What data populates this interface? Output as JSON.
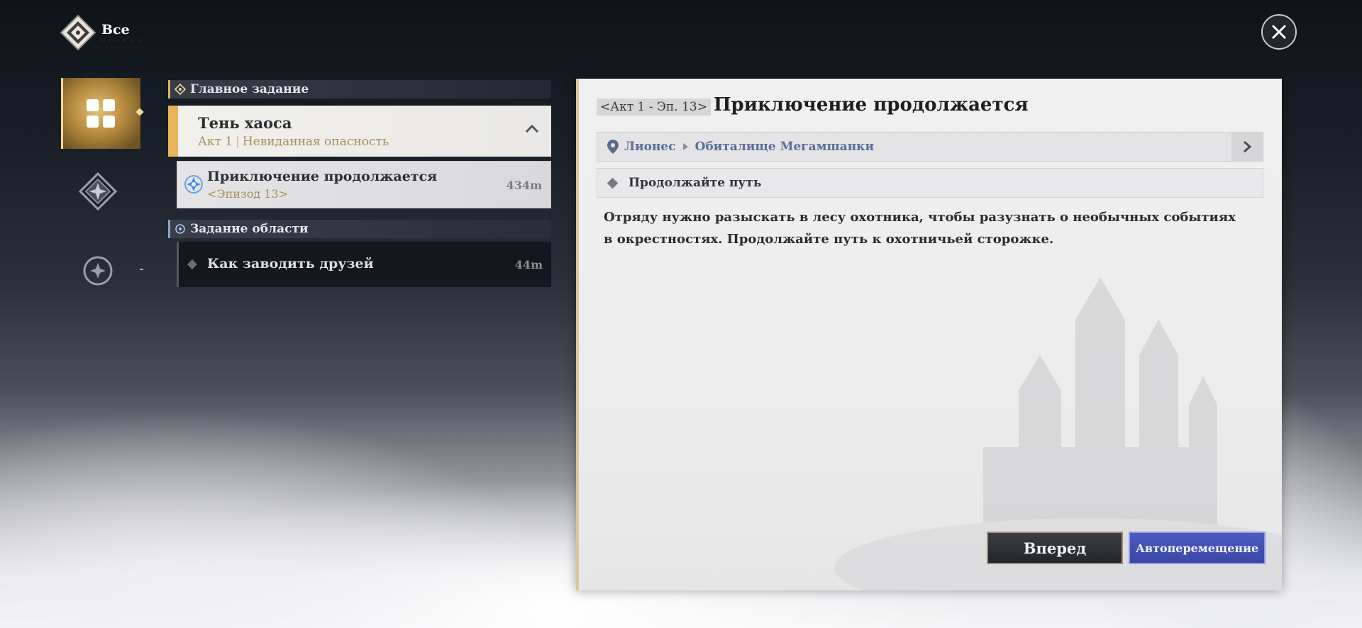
{
  "header": {
    "title": "Все",
    "subtitle": "· · · · · ·"
  },
  "nav": {
    "items": [
      {
        "name": "all-quests",
        "icon": "grid-icon",
        "active": true
      },
      {
        "name": "story",
        "icon": "diamond-star-icon",
        "active": false
      },
      {
        "name": "area",
        "icon": "circle-star-icon",
        "active": false
      }
    ]
  },
  "quests": {
    "main_section_label": "Главное задание",
    "chapter": {
      "title": "Тень хаоса",
      "act": "Акт 1",
      "separator": "|",
      "subtitle": "Невиданная опасность"
    },
    "selected": {
      "title": "Приключение продолжается",
      "episode": "<Эпизод 13>",
      "distance": "434m"
    },
    "area_section_label": "Задание области",
    "area_quest": {
      "title": "Как заводить друзей",
      "distance": "44m"
    }
  },
  "details": {
    "tag": "<Акт 1 - Эп. 13>",
    "title": "Приключение продолжается",
    "location": [
      "Лионес",
      "Обиталище Мегамшанки"
    ],
    "objective": "Продолжайте путь",
    "description": "Отряду нужно разыскать в лесу охотника, чтобы разузнать о необычных событиях в окрестностях. Продолжайте путь к охотничьей сторожке.",
    "buttons": {
      "go": "Вперед",
      "auto": "Автоперемещение"
    }
  },
  "colors": {
    "gold_accent": "#e8b45a",
    "auto_button": "#4c5bc0",
    "location_text": "#5a6f9a"
  }
}
